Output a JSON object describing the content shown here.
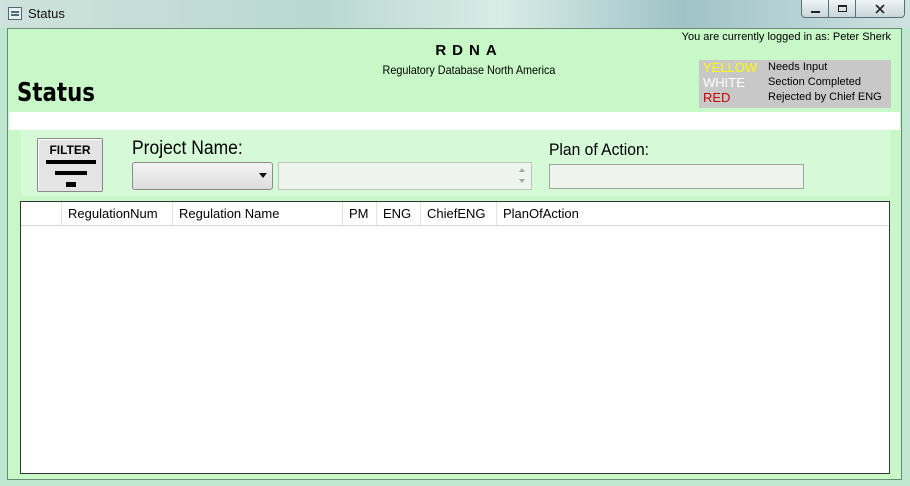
{
  "window": {
    "title": "Status",
    "icon": "app-window-icon"
  },
  "header": {
    "page_title": "Status",
    "app_name": "RDNA",
    "app_subtitle": "Regulatory Database North America",
    "login_text": "You are currently logged in as: Peter Sherk"
  },
  "legend": [
    {
      "key": "YELLOW",
      "desc": "Needs Input",
      "color": "#ffff00"
    },
    {
      "key": "WHITE",
      "desc": "Section Completed",
      "color": "#ffffff"
    },
    {
      "key": "RED",
      "desc": "Rejected by Chief ENG",
      "color": "#cc0000"
    }
  ],
  "filter": {
    "button_label": "FILTER",
    "project_label": "Project Name:",
    "project_selected": "",
    "project_text": "",
    "plan_label": "Plan of Action:",
    "plan_value": ""
  },
  "grid": {
    "columns": [
      "",
      "RegulationNum",
      "Regulation Name",
      "PM",
      "ENG",
      "ChiefENG",
      "PlanOfAction"
    ],
    "rows": []
  },
  "colors": {
    "background": "#c8f7c8",
    "panel": "#d6fad8"
  }
}
